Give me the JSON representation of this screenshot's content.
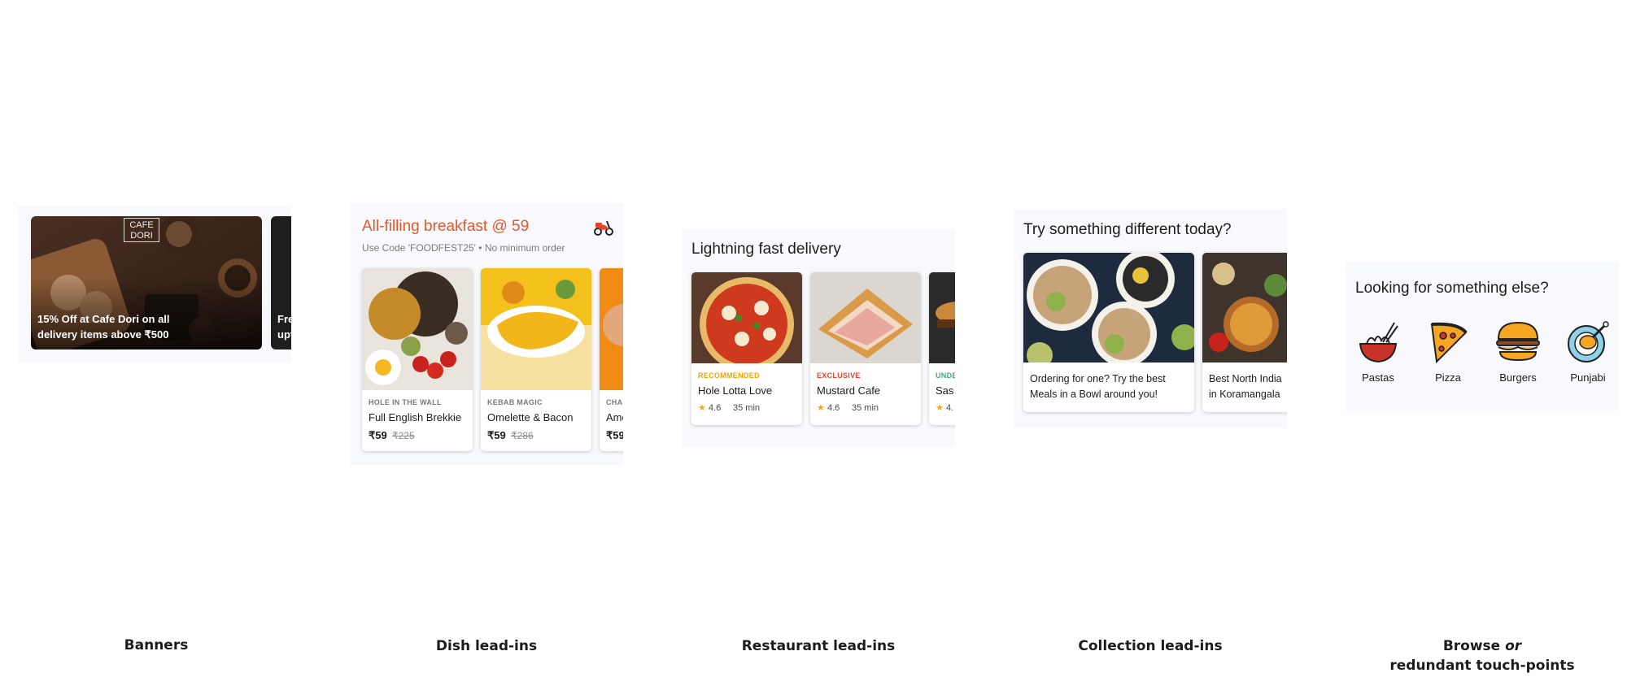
{
  "banners": {
    "items": [
      {
        "text_line1": "15% Off at Cafe Dori on all",
        "text_line2": "delivery items above ₹500",
        "logo_line1": "CAFE",
        "logo_line2": "DORI"
      },
      {
        "text_line1": "Fre",
        "text_line2": "upt"
      }
    ]
  },
  "dish": {
    "title": "All-filling breakfast @ 59",
    "subtitle": "Use Code 'FOODFEST25' • No minimum order",
    "title_color": "#e2582c",
    "icon": "scooter-icon",
    "cards": [
      {
        "tag": "HOLE IN THE WALL",
        "name": "Full English Brekkie",
        "price": "₹59",
        "old_price": "₹225"
      },
      {
        "tag": "KEBAB MAGIC",
        "name": "Omelette & Bacon",
        "price": "₹59",
        "old_price": "₹286"
      },
      {
        "tag": "CHAI",
        "name": "Ame",
        "price": "₹59"
      }
    ]
  },
  "restaurant": {
    "title": "Lightning fast delivery",
    "cards": [
      {
        "tag": "RECOMMENDED",
        "tag_color": "#f0a500",
        "name": "Hole Lotta Love",
        "rating": "4.6",
        "time": "35 min"
      },
      {
        "tag": "EXCLUSIVE",
        "tag_color": "#e2452c",
        "name": "Mustard Cafe",
        "rating": "4.6",
        "time": "35 min"
      },
      {
        "tag": "UNDE",
        "tag_color": "#3fae73",
        "name": "Sas",
        "rating": "4."
      }
    ]
  },
  "collection": {
    "title": "Try something different today?",
    "cards": [
      {
        "line1": "Ordering for one? Try the best",
        "line2": "Meals in a Bowl around you!"
      },
      {
        "line1": "Best North India",
        "line2": "in Koramangala"
      }
    ]
  },
  "browse": {
    "title": "Looking for something else?",
    "items": [
      {
        "label": "Pastas",
        "icon": "pasta-bowl-icon"
      },
      {
        "label": "Pizza",
        "icon": "pizza-slice-icon"
      },
      {
        "label": "Burgers",
        "icon": "burger-icon"
      },
      {
        "label": "Punjabi",
        "icon": "chicken-leg-icon"
      }
    ]
  },
  "captions": {
    "banners": "Banners",
    "dish": "Dish lead-ins",
    "restaurant": "Restaurant lead-ins",
    "collection": "Collection lead-ins",
    "browse_line1_a": "Browse ",
    "browse_line1_b": "or",
    "browse_line2": "redundant touch-points"
  }
}
